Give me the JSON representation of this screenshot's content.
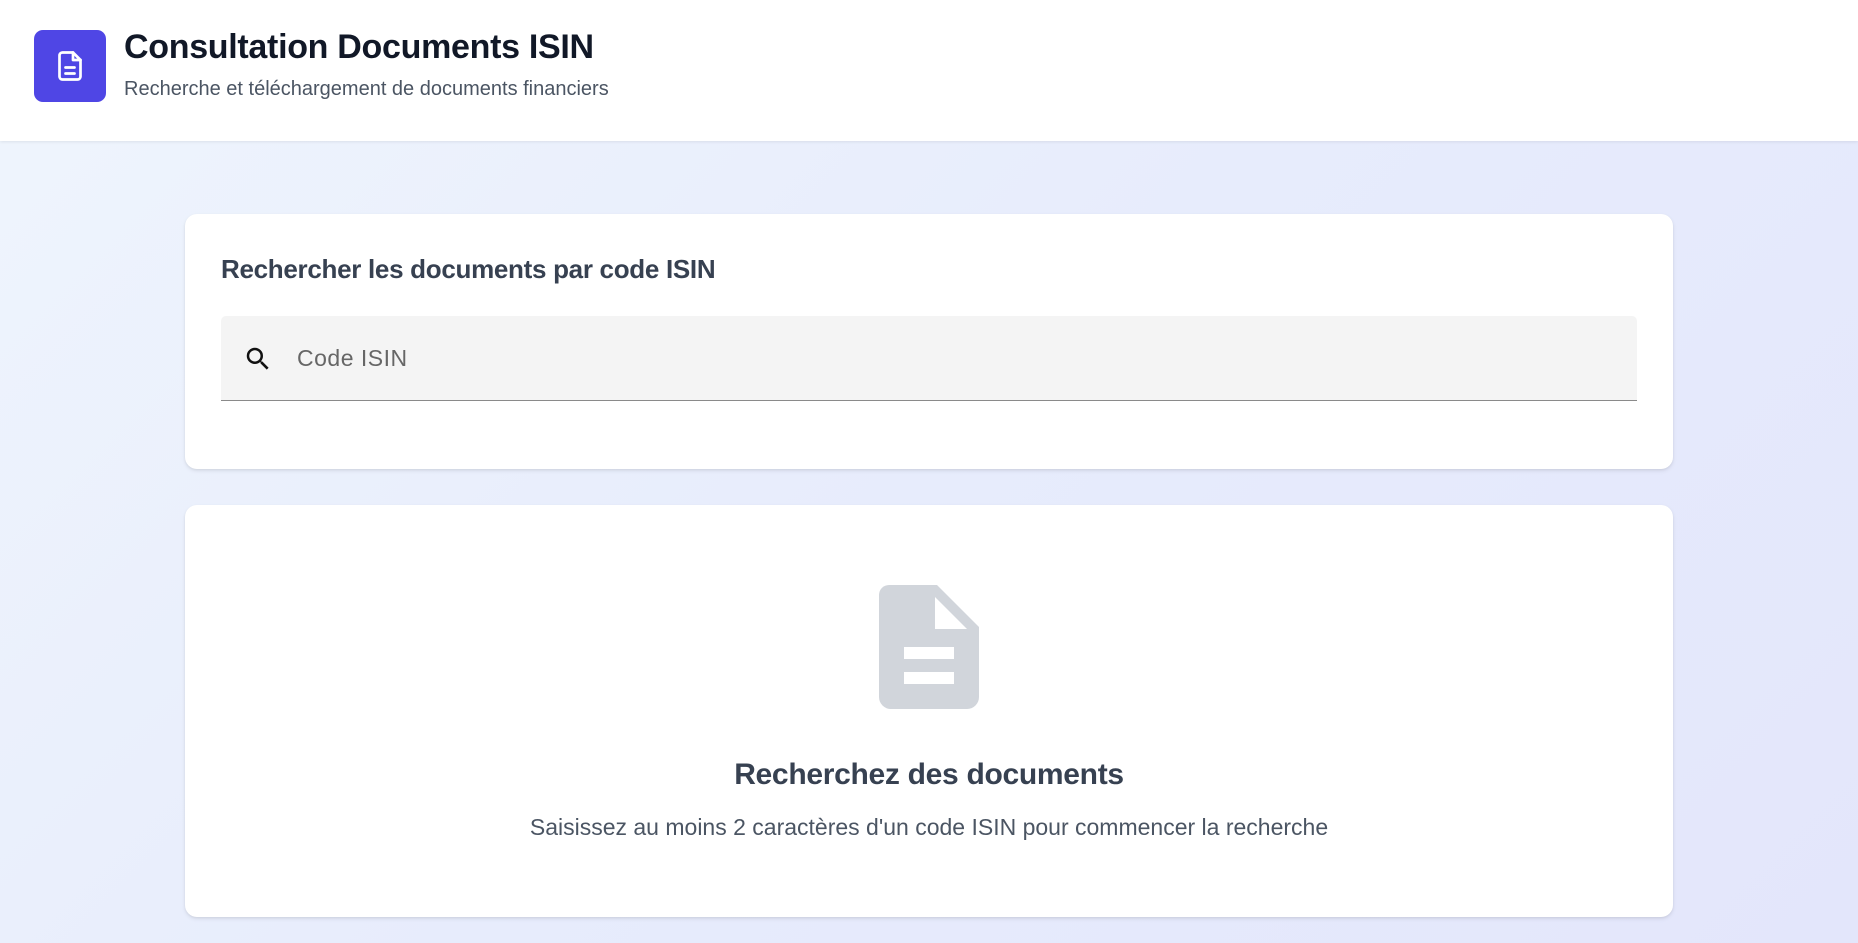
{
  "header": {
    "logo_icon": "document-icon",
    "title": "Consultation Documents ISIN",
    "subtitle": "Recherche et téléchargement de documents financiers"
  },
  "search": {
    "heading": "Rechercher les documents par code ISIN",
    "icon": "search-icon",
    "placeholder": "Code ISIN",
    "value": ""
  },
  "empty_state": {
    "icon": "document-icon",
    "title": "Recherchez des documents",
    "message": "Saisissez au moins 2 caractères d'un code ISIN pour commencer la recherche"
  },
  "colors": {
    "accent": "#4f46e5",
    "background": "#e9eefc",
    "card": "#ffffff",
    "empty_icon": "#d1d5db"
  }
}
